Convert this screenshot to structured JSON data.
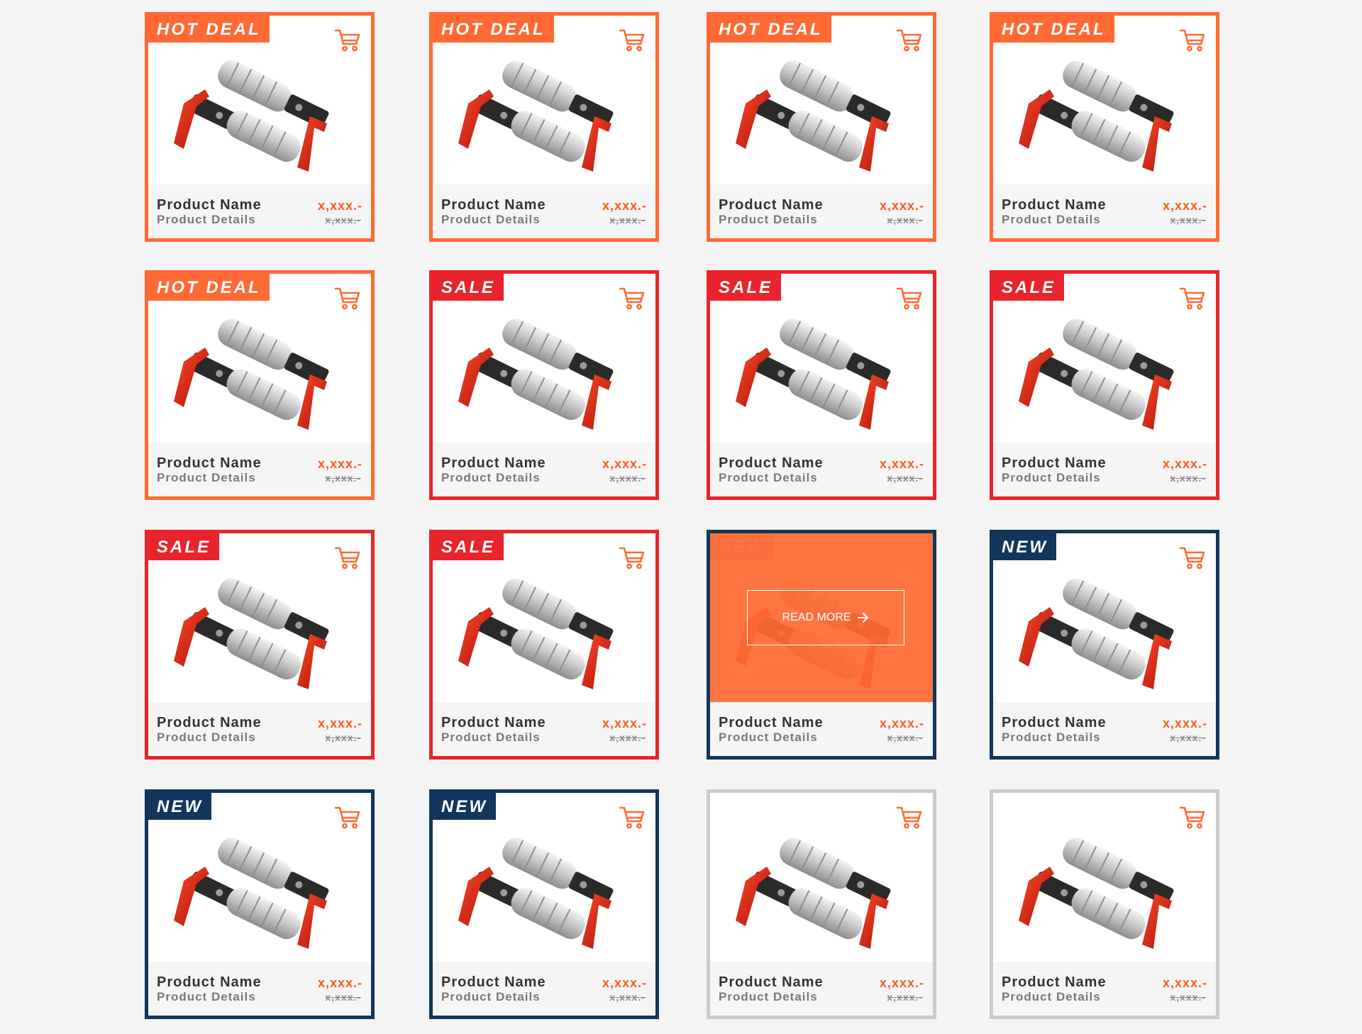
{
  "cards": [
    {
      "badge": "HOT DEAL",
      "variant": "hot",
      "name": "Product Name",
      "details": "Product Details",
      "price": "x,xxx.-",
      "old_price": "x,xxx.-"
    },
    {
      "badge": "HOT DEAL",
      "variant": "hot",
      "name": "Product Name",
      "details": "Product Details",
      "price": "x,xxx.-",
      "old_price": "x,xxx.-"
    },
    {
      "badge": "HOT DEAL",
      "variant": "hot",
      "name": "Product Name",
      "details": "Product Details",
      "price": "x,xxx.-",
      "old_price": "x,xxx.-"
    },
    {
      "badge": "HOT DEAL",
      "variant": "hot",
      "name": "Product Name",
      "details": "Product Details",
      "price": "x,xxx.-",
      "old_price": "x,xxx.-"
    },
    {
      "badge": "HOT DEAL",
      "variant": "hot",
      "name": "Product Name",
      "details": "Product Details",
      "price": "x,xxx.-",
      "old_price": "x,xxx.-"
    },
    {
      "badge": "SALE",
      "variant": "sale",
      "name": "Product Name",
      "details": "Product Details",
      "price": "x,xxx.-",
      "old_price": "x,xxx.-"
    },
    {
      "badge": "SALE",
      "variant": "sale",
      "name": "Product Name",
      "details": "Product Details",
      "price": "x,xxx.-",
      "old_price": "x,xxx.-"
    },
    {
      "badge": "SALE",
      "variant": "sale",
      "name": "Product Name",
      "details": "Product Details",
      "price": "x,xxx.-",
      "old_price": "x,xxx.-"
    },
    {
      "badge": "SALE",
      "variant": "sale",
      "name": "Product Name",
      "details": "Product Details",
      "price": "x,xxx.-",
      "old_price": "x,xxx.-"
    },
    {
      "badge": "SALE",
      "variant": "sale",
      "name": "Product Name",
      "details": "Product Details",
      "price": "x,xxx.-",
      "old_price": "x,xxx.-"
    },
    {
      "badge": "NEW",
      "variant": "new",
      "name": "Product Name",
      "details": "Product Details",
      "price": "x,xxx.-",
      "old_price": "x,xxx.-",
      "hovered": true,
      "overlay_label": "READ MORE"
    },
    {
      "badge": "NEW",
      "variant": "new",
      "name": "Product Name",
      "details": "Product Details",
      "price": "x,xxx.-",
      "old_price": "x,xxx.-"
    },
    {
      "badge": "NEW",
      "variant": "new",
      "name": "Product Name",
      "details": "Product Details",
      "price": "x,xxx.-",
      "old_price": "x,xxx.-"
    },
    {
      "badge": "NEW",
      "variant": "new",
      "name": "Product Name",
      "details": "Product Details",
      "price": "x,xxx.-",
      "old_price": "x,xxx.-"
    },
    {
      "badge": "",
      "variant": "plain",
      "name": "Product Name",
      "details": "Product Details",
      "price": "x,xxx.-",
      "old_price": "x,xxx.-"
    },
    {
      "badge": "",
      "variant": "plain",
      "name": "Product Name",
      "details": "Product Details",
      "price": "x,xxx.-",
      "old_price": "x,xxx.-"
    }
  ],
  "icons": {
    "cart": "shopping-cart-icon",
    "arrow": "arrow-right-icon"
  },
  "colors": {
    "hot_deal": "#ff6a34",
    "sale": "#e8242d",
    "new": "#12365c",
    "plain_border": "#cccccc",
    "price": "#ff5a1f"
  }
}
